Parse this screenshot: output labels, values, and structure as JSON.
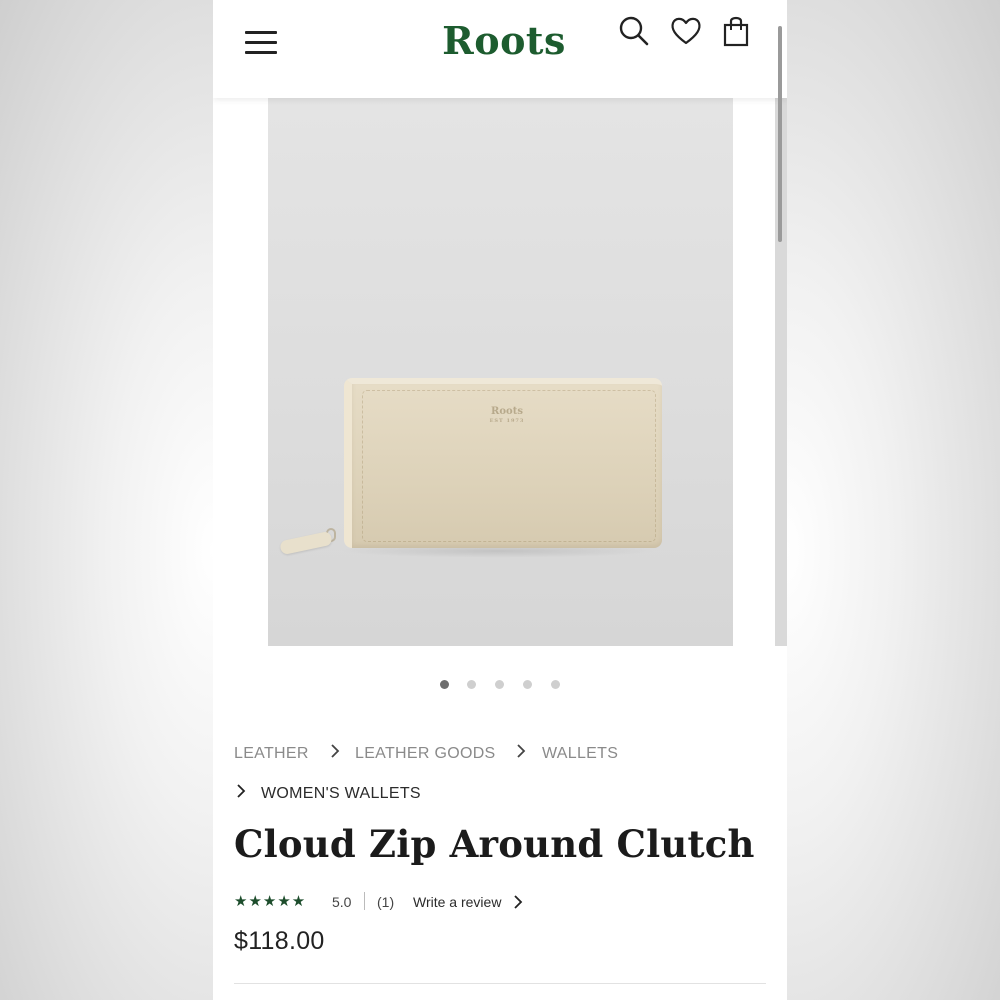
{
  "header": {
    "brand": "Roots",
    "menu_icon": "hamburger-menu-icon",
    "search_icon": "search-icon",
    "wishlist_icon": "heart-icon",
    "bag_icon": "shopping-bag-icon",
    "brand_color": "#1d5c2f"
  },
  "gallery": {
    "image_description": "cream leather zip around wallet",
    "wallet_imprint": "Roots",
    "wallet_imprint_sub": "EST 1973",
    "dots_total": 5,
    "active_dot": 1
  },
  "breadcrumbs": [
    {
      "label": "LEATHER"
    },
    {
      "label": "LEATHER GOODS"
    },
    {
      "label": "WALLETS"
    },
    {
      "label": "WOMEN'S WALLETS"
    }
  ],
  "product": {
    "title": "Cloud Zip Around Clutch",
    "stars": "★★★★★",
    "rating": "5.0",
    "review_count": "(1)",
    "write_review": "Write a review",
    "price": "$118.00",
    "star_color": "#1d4d2c"
  }
}
